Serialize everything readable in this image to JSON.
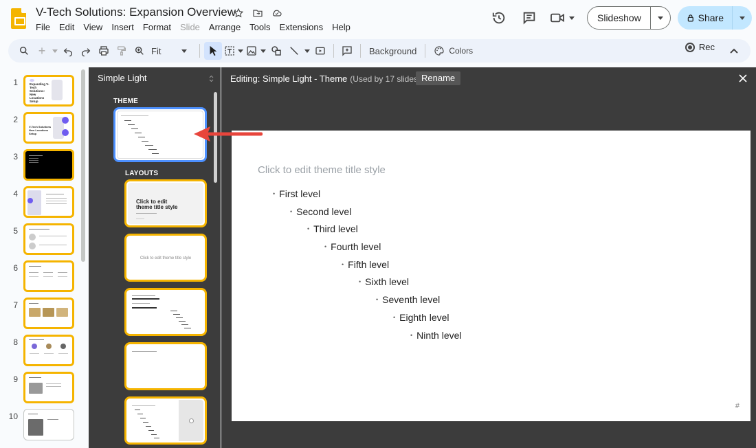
{
  "app": {
    "doc_title": "V-Tech Solutions: Expansion Overview",
    "menu": [
      "File",
      "Edit",
      "View",
      "Insert",
      "Format",
      "Slide",
      "Arrange",
      "Tools",
      "Extensions",
      "Help"
    ],
    "disabled_menu": "Slide",
    "slideshow_label": "Slideshow",
    "share_label": "Share"
  },
  "toolbar": {
    "zoom_label": "Fit",
    "background_label": "Background",
    "colors_label": "Colors",
    "rec_label": "Rec"
  },
  "filmstrip": {
    "slide_numbers": [
      "1",
      "2",
      "3",
      "4",
      "5",
      "6",
      "7",
      "8",
      "9",
      "10"
    ],
    "slide1_text": "Expanding V-Tech Solutions: New Locations Setup",
    "slide2_text": "V-Tech Solutions New Locations Setup"
  },
  "theme_panel": {
    "header": "Simple Light",
    "theme_section": "THEME",
    "layouts_section": "LAYOUTS",
    "layout1_title": "Click to edit theme title style",
    "layout2_title": "Click to edit theme title style"
  },
  "editor": {
    "editing_label": "Editing: Simple Light - Theme",
    "used_by": "(Used by 17 slides)",
    "rename_label": "Rename",
    "slide_title": "Click to edit theme title style",
    "levels": [
      "First level",
      "Second level",
      "Third level",
      "Fourth level",
      "Fifth level",
      "Sixth level",
      "Seventh level",
      "Eighth level",
      "Ninth level"
    ],
    "bullet": "•",
    "slide_number_placeholder": "#"
  },
  "colors": {
    "accent_yellow": "#f5b400",
    "selection_blue": "#4d90fe",
    "arrow_red": "#e8453c",
    "share_blue": "#c2e7ff"
  }
}
